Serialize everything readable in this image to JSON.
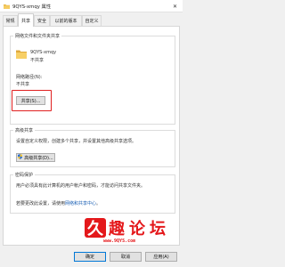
{
  "window": {
    "title": "9QYS-xmqy 属性",
    "close_glyph": "✕"
  },
  "tabs": [
    {
      "label": "常规"
    },
    {
      "label": "共享"
    },
    {
      "label": "安全"
    },
    {
      "label": "以前的版本"
    },
    {
      "label": "自定义"
    }
  ],
  "network_sharing": {
    "group_title": "网络文件和文件夹共享",
    "folder_name": "9QYS-xmqy",
    "share_status": "不共享",
    "path_label": "网络路径(N):",
    "path_value": "不共享",
    "share_button": "共享(S)..."
  },
  "advanced_sharing": {
    "group_title": "高级共享",
    "description": "设置自定义权限，创建多个共享，并设置其他高级共享选项。",
    "button": "高级共享(D)..."
  },
  "password_protection": {
    "group_title": "密码保护",
    "line1": "用户必须具有此计算机的用户帐户和密码，才能访问共享文件夹。",
    "line2_prefix": "若要更改此设置，请使用",
    "line2_link": "网络和共享中心",
    "line2_suffix": "。"
  },
  "footer": {
    "ok": "确定",
    "cancel": "取消",
    "apply": "应用(A)"
  },
  "watermark": {
    "brand": "久趣论坛",
    "url": "www.9QYS.com"
  },
  "colors": {
    "highlight": "#e02020",
    "link": "#1a5fb4",
    "watermark": "#e4181b"
  },
  "icons": [
    "folder-icon",
    "shield-icon",
    "close-icon"
  ]
}
